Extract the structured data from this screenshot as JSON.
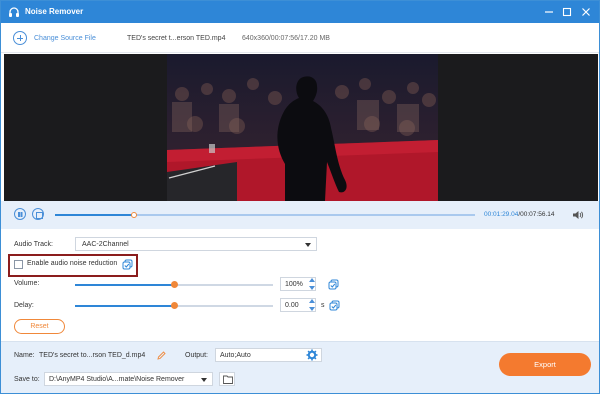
{
  "window": {
    "title": "Noise Remover",
    "accent_color": "#2e86d7",
    "highlight_color": "#f47a2f"
  },
  "toolbar": {
    "change_source_label": "Change Source File",
    "file_name": "TED's secret t...erson  TED.mp4",
    "file_meta": "640x360/00:07:56/17.20 MB"
  },
  "player": {
    "current_time": "00:01:29.04",
    "total_time": "/00:07:56.14",
    "progress": 0.187
  },
  "settings": {
    "audio_track_label": "Audio Track:",
    "audio_track_value": "AAC-2Channel",
    "noise_reduction_label": "Enable audio noise reduction",
    "noise_reduction_checked": false,
    "volume_label": "Volume:",
    "volume_value": "100%",
    "volume_level": 0.5,
    "delay_label": "Delay:",
    "delay_value": "0.00",
    "delay_unit": "s",
    "delay_level": 0.5,
    "reset_label": "Reset"
  },
  "bottom": {
    "name_label": "Name:",
    "name_value": "TED's secret to...rson  TED_d.mp4",
    "output_label": "Output:",
    "output_value": "Auto;Auto",
    "save_to_label": "Save to:",
    "save_to_value": "D:\\AnyMP4 Studio\\A...mate\\Noise Remover",
    "export_label": "Export"
  }
}
